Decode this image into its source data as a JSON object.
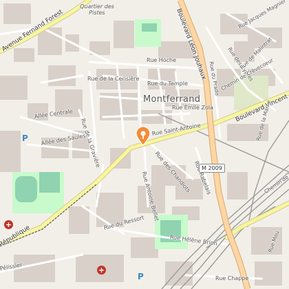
{
  "map": {
    "city_label": "Montferrand",
    "district_label": "Quartier des Pistes",
    "road_ref": "M 2009",
    "marker": {
      "icon": "map-pin-icon",
      "color": "#f28c38"
    },
    "roads": {
      "avenue_fernand_forest": "Avenue Fernand Forest",
      "boulevard_leon_jouhaux": "Boulevard Léon Jouhaux",
      "boulevard_vincent": "Boulevard Vincent",
      "republique": "République",
      "rue_hoche": "Rue Hoche",
      "rue_de_la_cerisiere": "Rue de la Cerisière",
      "rue_du_temple": "Rue du Temple",
      "rue_emile_zola": "Rue Émile Zola",
      "rue_saint_antoine": "Rue Saint-Antoine",
      "allee_centrale": "Allée Centrale",
      "allee_des_saules": "Allée des Saules",
      "rue_de_la_graviere": "Rue de la Gravière",
      "rue_des_chandiots": "Rue des Chandiots",
      "rue_antoine_bellet": "Rue Antoine Bellet",
      "rue_rabelais": "Rue Rabelais",
      "rue_du_ressort": "Rue du Ressort",
      "rue_helene_brion": "Rue Hélène Brion",
      "rue_chappe": "Rue Chappe",
      "rue_jacques_magnier": "Rue Jacques Magnier",
      "rue_des_cypres": "Rue des Cyprès",
      "rue_du_prado": "Rue du Prado",
      "rue_de_malintrat": "Rue de Malintrat",
      "chemin_de_crevecoeur": "Chemin de Crèvecoeur",
      "rue_de_la_marne": "Rue de la Marne",
      "rue_pelissier": "Pélissier",
      "chemin_de_fer": "Chemin de Fer",
      "rue_mou": "Rue Mou"
    },
    "colors": {
      "background": "#f2efe9",
      "building": "#d9d0c9",
      "park": "#c8facc",
      "pitch": "#8fd3b0",
      "major_road": "#f6f6a0",
      "trunk": "#fcd6a4",
      "rail": "#999999",
      "hospital": "#c0352b",
      "parking": "#3b88c3"
    }
  }
}
